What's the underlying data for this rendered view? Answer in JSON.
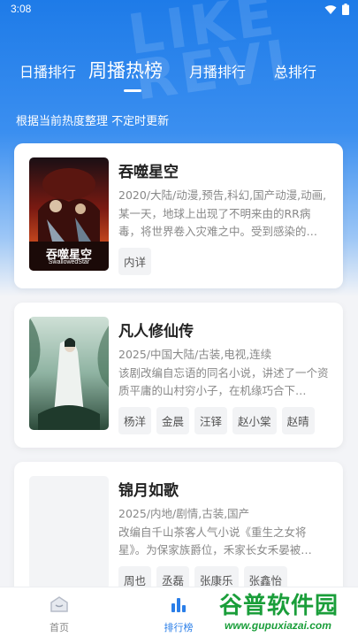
{
  "status": {
    "time": "3:08"
  },
  "tabs": [
    {
      "label": "日播排行"
    },
    {
      "label": "周播热榜"
    },
    {
      "label": "月播排行"
    },
    {
      "label": "总排行"
    }
  ],
  "active_tab": "周播热榜",
  "subtitle": "根据当前热度整理 不定时更新",
  "items": [
    {
      "title": "吞噬星空",
      "meta": "2020/大陆/动漫,预告,科幻,国产动漫,动画,",
      "desc": "某一天，地球上出现了不明来由的RR病毒，将世界卷入灾难之中。受到感染的…",
      "chips": [
        "内详"
      ],
      "poster_text": "吞噬星空",
      "poster_sub": "SwallowedStar"
    },
    {
      "title": "凡人修仙传",
      "meta": "2025/中国大陆/古装,电视,连续",
      "desc": "该剧改编自忘语的同名小说，讲述了一个资质平庸的山村穷小子，在机缘巧合下…",
      "chips": [
        "杨洋",
        "金晨",
        "汪铎",
        "赵小棠",
        "赵晴"
      ]
    },
    {
      "title": "锦月如歌",
      "meta": "2025/内地/剧情,古装,国产",
      "desc": "改编自千山茶客人气小说《重生之女将星》。为保家族爵位，禾家长女禾晏被…",
      "chips": [
        "周也",
        "丞磊",
        "张康乐",
        "张鑫怡"
      ]
    }
  ],
  "bottom_nav": [
    {
      "label": "首页",
      "icon": "home-icon"
    },
    {
      "label": "排行榜",
      "icon": "chart-icon"
    }
  ],
  "watermark": {
    "text": "谷普软件园",
    "url": "www.gupuxiazai.com"
  },
  "colors": {
    "primary": "#1e7be8",
    "card_bg": "#ffffff",
    "page_bg": "#f3f4f7"
  }
}
